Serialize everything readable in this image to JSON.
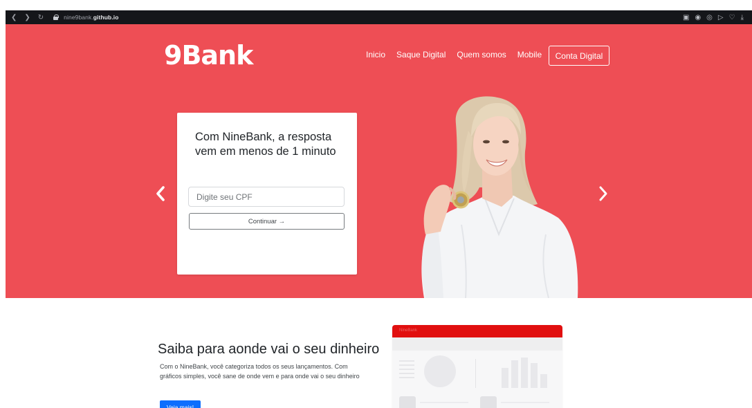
{
  "browser": {
    "url_prefix": "nine9bank.",
    "url_domain": "github.io",
    "nav_icons": [
      "back-icon",
      "forward-icon",
      "reload-icon"
    ],
    "extension_icons": [
      "photo-icon",
      "camera-icon",
      "settings-icon",
      "send-icon",
      "heart-icon",
      "download-icon"
    ]
  },
  "header": {
    "logo": "9Bank",
    "nav": [
      "Inicio",
      "Saque Digital",
      "Quem somos",
      "Mobile"
    ],
    "cta": "Conta Digital"
  },
  "hero": {
    "title": "Com NineBank, a resposta vem em menos de 1 minuto",
    "cpf_placeholder": "Digite seu CPF",
    "continue_label": "Continuar →",
    "prev_icon": "chevron-left-icon",
    "next_icon": "chevron-right-icon"
  },
  "feature": {
    "title": "Saiba para aonde vai o seu dinheiro",
    "text": "Com o NineBank, você categoriza todos os seus lançamentos. Com gráficos simples, você sane de onde vem e para onde vai o seu dinheiro",
    "button": "Veja mais!",
    "mock_header": "NineBank"
  },
  "colors": {
    "hero_bg": "#ee4e55",
    "chrome_bg": "#15161a",
    "feature_button": "#0d6efd",
    "mock_header": "#e10f0f"
  }
}
